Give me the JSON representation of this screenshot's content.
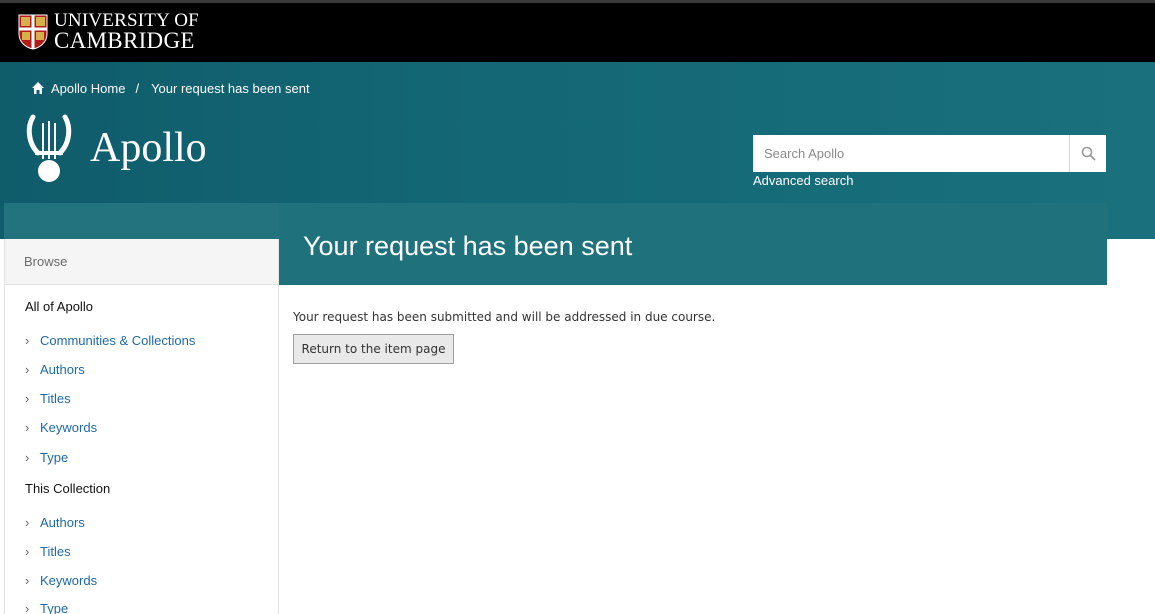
{
  "header": {
    "university_line1": "UNIVERSITY OF",
    "university_line2": "CAMBRIDGE",
    "crest_icon": "university-crest-icon"
  },
  "breadcrumb": {
    "home_icon": "home-icon",
    "home_label": "Apollo Home",
    "separator": "/",
    "current": "Your request has been sent"
  },
  "brand": {
    "logo_icon": "lyre-icon",
    "name": "Apollo"
  },
  "search": {
    "placeholder": "Search Apollo",
    "button_icon": "search-icon",
    "advanced_label": "Advanced search"
  },
  "page": {
    "title": "Your request has been sent",
    "message": "Your request has been submitted and will be addressed in due course.",
    "return_button": "Return to the item page"
  },
  "sidebar": {
    "header": "Browse",
    "groups": [
      {
        "title": "All of Apollo",
        "items": [
          "Communities & Collections",
          "Authors",
          "Titles",
          "Keywords",
          "Type"
        ]
      },
      {
        "title": "This Collection",
        "items": [
          "Authors",
          "Titles",
          "Keywords",
          "Type"
        ]
      }
    ]
  },
  "colors": {
    "topbar": "#000000",
    "brand_band": "#146876",
    "title_band": "#1f717c",
    "link": "#1f6aa5"
  }
}
